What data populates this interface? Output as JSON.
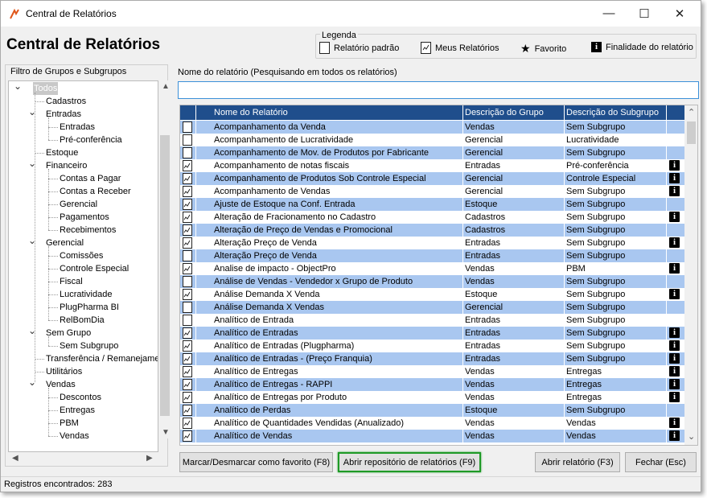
{
  "window": {
    "title": "Central de Relatórios",
    "controls": {
      "minimize": "—",
      "maximize": "☐",
      "close": "✕"
    }
  },
  "header": {
    "title": "Central de Relatórios"
  },
  "legend": {
    "title": "Legenda",
    "items": [
      {
        "label": "Relatório padrão",
        "icon": "blank-document-icon"
      },
      {
        "label": "Meus Relatórios",
        "icon": "chart-document-icon"
      },
      {
        "label": "Favorito",
        "icon": "star-icon"
      },
      {
        "label": "Finalidade do relatório",
        "icon": "info-icon"
      }
    ]
  },
  "tree": {
    "label": "Filtro de Grupos e Subgrupos",
    "nodes": [
      {
        "label": "Todos",
        "level": 0,
        "expander": "open",
        "selected": true
      },
      {
        "label": "Cadastros",
        "level": 1,
        "expander": "none"
      },
      {
        "label": "Entradas",
        "level": 1,
        "expander": "open"
      },
      {
        "label": "Entradas",
        "level": 2,
        "expander": "none"
      },
      {
        "label": "Pré-conferência",
        "level": 2,
        "expander": "none"
      },
      {
        "label": "Estoque",
        "level": 1,
        "expander": "none"
      },
      {
        "label": "Financeiro",
        "level": 1,
        "expander": "open"
      },
      {
        "label": "Contas a Pagar",
        "level": 2,
        "expander": "none"
      },
      {
        "label": "Contas a Receber",
        "level": 2,
        "expander": "none"
      },
      {
        "label": "Gerencial",
        "level": 2,
        "expander": "none"
      },
      {
        "label": "Pagamentos",
        "level": 2,
        "expander": "none"
      },
      {
        "label": "Recebimentos",
        "level": 2,
        "expander": "none"
      },
      {
        "label": "Gerencial",
        "level": 1,
        "expander": "open"
      },
      {
        "label": "Comissões",
        "level": 2,
        "expander": "none"
      },
      {
        "label": "Controle Especial",
        "level": 2,
        "expander": "none"
      },
      {
        "label": "Fiscal",
        "level": 2,
        "expander": "none"
      },
      {
        "label": "Lucratividade",
        "level": 2,
        "expander": "none"
      },
      {
        "label": "PlugPharma BI",
        "level": 2,
        "expander": "none"
      },
      {
        "label": "RelBomDia",
        "level": 2,
        "expander": "none"
      },
      {
        "label": "Sem Grupo",
        "level": 1,
        "expander": "open"
      },
      {
        "label": "Sem Subgrupo",
        "level": 2,
        "expander": "none"
      },
      {
        "label": "Transferência / Remanejame",
        "level": 1,
        "expander": "none"
      },
      {
        "label": "Utilitários",
        "level": 1,
        "expander": "none"
      },
      {
        "label": "Vendas",
        "level": 1,
        "expander": "open"
      },
      {
        "label": "Descontos",
        "level": 2,
        "expander": "none"
      },
      {
        "label": "Entregas",
        "level": 2,
        "expander": "none"
      },
      {
        "label": "PBM",
        "level": 2,
        "expander": "none"
      },
      {
        "label": "Vendas",
        "level": 2,
        "expander": "none"
      }
    ]
  },
  "search": {
    "label": "Nome do relatório (Pesquisando em todos os relatórios)",
    "value": ""
  },
  "table": {
    "columns": [
      "Nome do Relatório",
      "Descrição do Grupo",
      "Descrição do Subgrupo"
    ],
    "rows": [
      {
        "icon": "blank",
        "name": "Acompanhamento da Venda",
        "group": "Vendas",
        "subgroup": "Sem Subgrupo",
        "info": false
      },
      {
        "icon": "blank",
        "name": "Acompanhamento de Lucratividade",
        "group": "Gerencial",
        "subgroup": "Lucratividade",
        "info": false
      },
      {
        "icon": "blank",
        "name": "Acompanhamento de Mov. de Produtos por Fabricante",
        "group": "Gerencial",
        "subgroup": "Sem Subgrupo",
        "info": false
      },
      {
        "icon": "chart",
        "name": "Acompanhamento de notas fiscais",
        "group": "Entradas",
        "subgroup": "Pré-conferência",
        "info": true
      },
      {
        "icon": "chart",
        "name": "Acompanhamento de Produtos Sob Controle Especial",
        "group": "Gerencial",
        "subgroup": "Controle Especial",
        "info": true
      },
      {
        "icon": "chart",
        "name": "Acompanhamento de Vendas",
        "group": "Gerencial",
        "subgroup": "Sem Subgrupo",
        "info": true
      },
      {
        "icon": "chart",
        "name": "Ajuste de Estoque na Conf. Entrada",
        "group": "Estoque",
        "subgroup": "Sem Subgrupo",
        "info": false
      },
      {
        "icon": "chart",
        "name": "Alteração de Fracionamento no Cadastro",
        "group": "Cadastros",
        "subgroup": "Sem Subgrupo",
        "info": true
      },
      {
        "icon": "chart",
        "name": "Alteração de Preço de Vendas e Promocional",
        "group": "Cadastros",
        "subgroup": "Sem Subgrupo",
        "info": false
      },
      {
        "icon": "chart",
        "name": "Alteração Preço de Venda",
        "group": "Entradas",
        "subgroup": "Sem Subgrupo",
        "info": true
      },
      {
        "icon": "blank",
        "name": "Alteração Preço de Venda",
        "group": "Entradas",
        "subgroup": "Sem Subgrupo",
        "info": false
      },
      {
        "icon": "chart",
        "name": "Analise de impacto - ObjectPro",
        "group": "Vendas",
        "subgroup": "PBM",
        "info": true
      },
      {
        "icon": "blank",
        "name": "Análise de Vendas - Vendedor x Grupo de Produto",
        "group": "Vendas",
        "subgroup": "Sem Subgrupo",
        "info": false
      },
      {
        "icon": "chart",
        "name": "Análise Demanda X Venda",
        "group": "Estoque",
        "subgroup": "Sem Subgrupo",
        "info": true
      },
      {
        "icon": "blank",
        "name": "Análise Demanda X Vendas",
        "group": "Gerencial",
        "subgroup": "Sem Subgrupo",
        "info": false
      },
      {
        "icon": "blank",
        "name": "Analítico de Entrada",
        "group": "Entradas",
        "subgroup": "Sem Subgrupo",
        "info": false
      },
      {
        "icon": "chart",
        "name": "Analítico de Entradas",
        "group": "Entradas",
        "subgroup": "Sem Subgrupo",
        "info": true
      },
      {
        "icon": "chart",
        "name": "Analítico de Entradas (Plugpharma)",
        "group": "Entradas",
        "subgroup": "Sem Subgrupo",
        "info": true
      },
      {
        "icon": "chart",
        "name": "Analítico de Entradas - (Preço Franquia)",
        "group": "Entradas",
        "subgroup": "Sem Subgrupo",
        "info": true
      },
      {
        "icon": "chart",
        "name": "Analítico de Entregas",
        "group": "Vendas",
        "subgroup": "Entregas",
        "info": true
      },
      {
        "icon": "chart",
        "name": "Analítico de Entregas - RAPPI",
        "group": "Vendas",
        "subgroup": "Entregas",
        "info": true
      },
      {
        "icon": "chart",
        "name": "Analítico de Entregas por Produto",
        "group": "Vendas",
        "subgroup": "Entregas",
        "info": true
      },
      {
        "icon": "chart",
        "name": "Analítico de Perdas",
        "group": "Estoque",
        "subgroup": "Sem Subgrupo",
        "info": false
      },
      {
        "icon": "chart",
        "name": "Analítico de Quantidades Vendidas (Anualizado)",
        "group": "Vendas",
        "subgroup": "Vendas",
        "info": true
      },
      {
        "icon": "chart",
        "name": "Analítico de Vendas",
        "group": "Vendas",
        "subgroup": "Vendas",
        "info": true
      }
    ]
  },
  "buttons": {
    "favorite": "Marcar/Desmarcar como favorito (F8)",
    "repository": "Abrir repositório de relatórios (F9)",
    "open": "Abrir relatório (F3)",
    "close": "Fechar (Esc)"
  },
  "status": {
    "text": "Registros encontrados: 283"
  },
  "colors": {
    "header_bg": "#1f4e8c",
    "row_alt": "#a9c7f0",
    "highlight_border": "#1e9a26"
  }
}
